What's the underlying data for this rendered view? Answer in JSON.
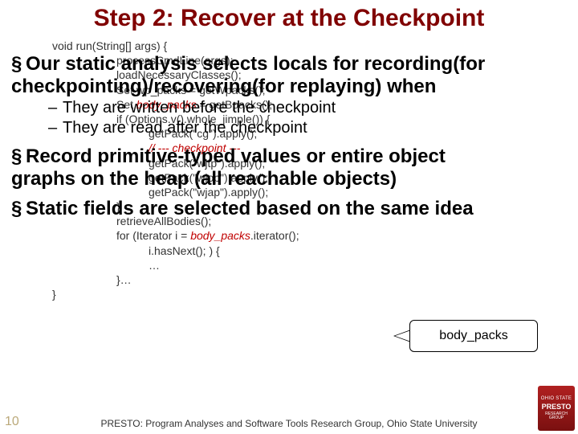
{
  "title": "Step 2: Recover at the Checkpoint",
  "code": {
    "l0": "void run(String[] args) {",
    "l1": "processCmdLine(args);",
    "l2": "loadNecessaryClasses();",
    "l3": "Set wp_packs = getWpacks();",
    "l4a": "Set ",
    "l4b": "body_packs",
    "l4c": " = getBpacks();",
    "l5": "if (Options.v().whole_jimple()) {",
    "l6": "getPack(\"cg\").apply();",
    "l7": "// --- checkpoint ---",
    "l8": "getPack(\"wjtp\").apply();",
    "l9": "getPack(\"wjop\").apply();",
    "l10": "getPack(\"wjap\").apply();",
    "l11": "}",
    "l12": "retrieveAllBodies();",
    "l13a": "for (Iterator i = ",
    "l13b": "body_packs",
    "l13c": ".iterator();",
    "l14": "i.hasNext(); ) {",
    "l15": "…",
    "l16": "}…",
    "l17": "}"
  },
  "bullets": {
    "b1": "Our static analysis selects locals for recording(for checkpointing)/recovering(for replaying) when",
    "b1s1": "They are written before the checkpoint",
    "b1s2": "They are read after the checkpoint",
    "b2": "Record primitive-typed values or entire object graphs on the heap (all reachable objects)",
    "b3": "Static fields are selected based on the same idea"
  },
  "callout_bp": "body_packs",
  "slide_number": "10",
  "footer": "PRESTO: Program Analyses and Software Tools Research Group, Ohio State University",
  "logo": {
    "top": "OHIO STATE",
    "mid": "PRESTO",
    "bot": "RESEARCH GROUP"
  }
}
